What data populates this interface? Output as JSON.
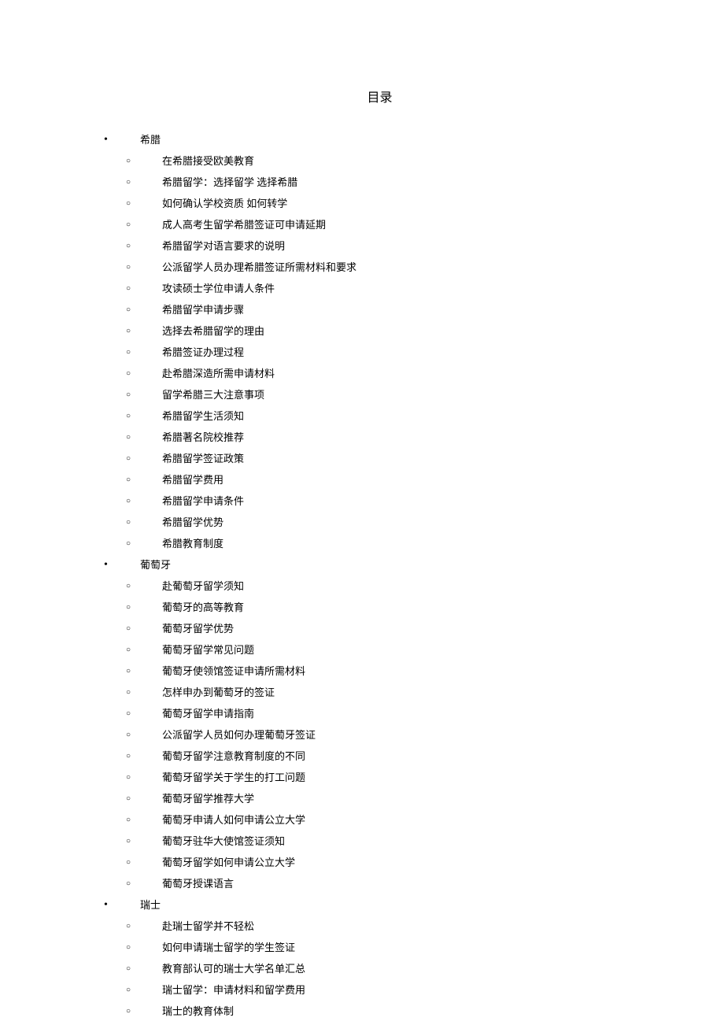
{
  "title": "目录",
  "toc": [
    {
      "country": "希腊",
      "items": [
        "在希腊接受欧美教育",
        "希腊留学：选择留学 选择希腊",
        "如何确认学校资质 如何转学",
        "成人高考生留学希腊签证可申请延期",
        "希腊留学对语言要求的说明",
        "公派留学人员办理希腊签证所需材料和要求",
        "攻读硕士学位申请人条件",
        "希腊留学申请步骤",
        "选择去希腊留学的理由",
        "希腊签证办理过程",
        "赴希腊深造所需申请材料",
        "留学希腊三大注意事项",
        "希腊留学生活须知",
        "希腊著名院校推荐",
        "希腊留学签证政策",
        "希腊留学费用",
        "希腊留学申请条件",
        "希腊留学优势",
        "希腊教育制度"
      ]
    },
    {
      "country": "葡萄牙",
      "items": [
        "赴葡萄牙留学须知",
        "葡萄牙的高等教育",
        "葡萄牙留学优势",
        "葡萄牙留学常见问题",
        "葡萄牙使领馆签证申请所需材料",
        "怎样申办到葡萄牙的签证",
        "葡萄牙留学申请指南",
        "公派留学人员如何办理葡萄牙签证",
        "葡萄牙留学注意教育制度的不同",
        "葡萄牙留学关于学生的打工问题",
        "葡萄牙留学推荐大学",
        "葡萄牙申请人如何申请公立大学",
        "葡萄牙驻华大使馆签证须知",
        "葡萄牙留学如何申请公立大学",
        "葡萄牙授课语言"
      ]
    },
    {
      "country": "瑞士",
      "items": [
        "赴瑞士留学并不轻松",
        "如何申请瑞士留学的学生签证",
        "教育部认可的瑞士大学名单汇总",
        "瑞士留学：申请材料和留学费用",
        "瑞士的教育体制"
      ]
    }
  ]
}
